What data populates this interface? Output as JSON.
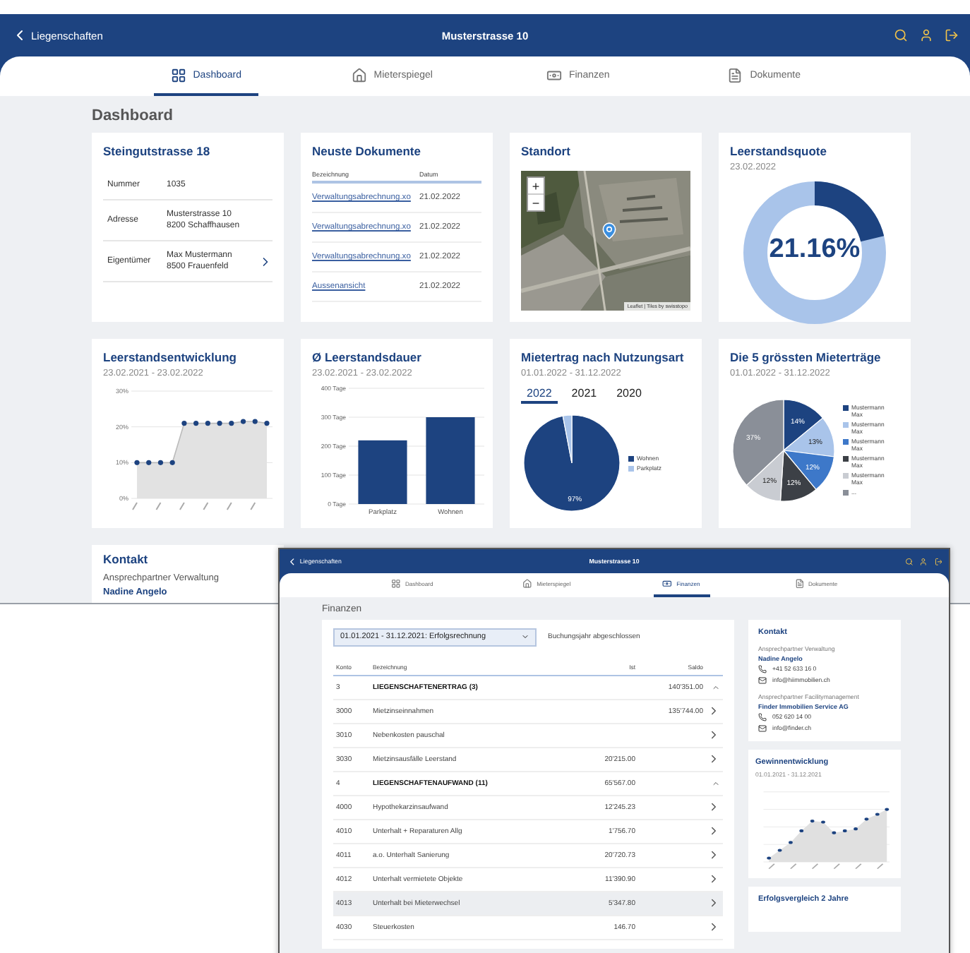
{
  "dashboard_window": {
    "header": {
      "back_label": "Liegenschaften",
      "title": "Musterstrasse 10"
    },
    "tabs": [
      {
        "label": "Dashboard",
        "selected": true
      },
      {
        "label": "Mieterspiegel",
        "selected": false
      },
      {
        "label": "Finanzen",
        "selected": false
      },
      {
        "label": "Dokumente",
        "selected": false
      }
    ],
    "page_title": "Dashboard",
    "property_card": {
      "title": "Steingutstrasse 18",
      "rows": [
        {
          "label": "Nummer",
          "lines": [
            "1035"
          ],
          "link": false
        },
        {
          "label": "Adresse",
          "lines": [
            "Musterstrasse 10",
            "8200 Schaffhausen"
          ],
          "link": false
        },
        {
          "label": "Eigentümer",
          "lines": [
            "Max Mustermann",
            "8500 Frauenfeld"
          ],
          "link": true
        }
      ]
    },
    "documents_card": {
      "title": "Neuste Dokumente",
      "columns": [
        "Bezeichnung",
        "Datum"
      ],
      "rows": [
        {
          "name": "Verwaltungsabrechnung.xo",
          "date": "21.02.2022"
        },
        {
          "name": "Verwaltungsabrechnung.xo",
          "date": "21.02.2022"
        },
        {
          "name": "Verwaltungsabrechnung.xo",
          "date": "21.02.2022"
        },
        {
          "name": "Aussenansicht",
          "date": "21.02.2022"
        }
      ]
    },
    "location_card": {
      "title": "Standort",
      "zoom_in": "+",
      "zoom_out": "−",
      "attribution": "Leaflet | Tiles by swisstopo"
    },
    "vacancy_card": {
      "title": "Leerstandsquote",
      "date": "23.02.2022",
      "reading": "21.16%",
      "level": 0.2116
    },
    "vacancy_trend": {
      "title": "Leerstandsentwicklung",
      "range": "23.02.2021 - 23.02.2022",
      "chart_data": {
        "type": "area",
        "grid": true,
        "values": [
          10,
          10,
          10,
          10,
          21,
          21,
          21,
          21,
          21,
          21.5,
          21.5,
          21
        ],
        "ylim": [
          0,
          30
        ],
        "yticks": [
          {
            "value": 0,
            "label": "0%"
          },
          {
            "value": 10,
            "label": "10%"
          },
          {
            "value": 20,
            "label": "20%"
          },
          {
            "value": 30,
            "label": "30%"
          }
        ]
      }
    },
    "vacancy_duration": {
      "title": "Ø Leerstandsdauer",
      "range": "23.02.2021 - 23.02.2022",
      "chart_data": {
        "type": "bar",
        "grid": true,
        "categories": [
          "Parkplatz",
          "Wohnen"
        ],
        "values": [
          220,
          300
        ],
        "ylim": [
          0,
          400
        ],
        "yticks": [
          {
            "value": 0,
            "label": "0 Tage"
          },
          {
            "value": 100,
            "label": "100 Tage"
          },
          {
            "value": 200,
            "label": "200 Tage"
          },
          {
            "value": 300,
            "label": "300 Tage"
          },
          {
            "value": 400,
            "label": "400 Tage"
          }
        ]
      }
    },
    "income_by_use": {
      "title": "Mietertrag nach Nutzungsart",
      "range": "01.01.2022 - 31.12.2022",
      "years": [
        {
          "label": "2022",
          "selected": true
        },
        {
          "label": "2021",
          "selected": false
        },
        {
          "label": "2020",
          "selected": false
        }
      ],
      "chart_data": {
        "type": "pie",
        "categories": [
          "Wohnen",
          "Parkplatz"
        ],
        "values": [
          97,
          3
        ],
        "value_labels": [
          "97%",
          null
        ]
      }
    },
    "top_income": {
      "title": "Die 5 grössten Mieterträge",
      "range": "01.01.2022 - 31.12.2022",
      "chart_data": {
        "type": "pie",
        "categories": [
          "Mustermann Max",
          "Mustermann Max",
          "Mustermann Max",
          "Mustermann Max",
          "Mustermann Max",
          "..."
        ],
        "values": [
          14,
          13,
          12,
          12,
          12,
          37
        ],
        "value_labels": [
          "14%",
          "13%",
          "12%",
          "12%",
          "12%",
          "37%"
        ]
      }
    },
    "contact_card": {
      "title": "Kontakt",
      "subtitle": "Ansprechpartner Verwaltung",
      "name": "Nadine Angelo"
    }
  },
  "finance_window": {
    "header": {
      "back_label": "Liegenschaften",
      "title": "Musterstrasse 10"
    },
    "tabs": [
      {
        "label": "Dashboard",
        "selected": false
      },
      {
        "label": "Mieterspiegel",
        "selected": false
      },
      {
        "label": "Finanzen",
        "selected": true
      },
      {
        "label": "Dokumente",
        "selected": false
      }
    ],
    "page_title": "Finanzen",
    "period": "01.01.2021 - 31.12.2021: Erfolgsrechnung",
    "status": "Buchungsjahr abgeschlossen",
    "columns": [
      "Konto",
      "Bezeichnung",
      "Ist",
      "Saldo"
    ],
    "rows": [
      {
        "kind": "group",
        "account": "3",
        "name": "LIEGENSCHAFTENERTRAG (3)",
        "actual": "",
        "balance": "140'351.00",
        "expanded": true,
        "selected": false
      },
      {
        "kind": "item",
        "account": "3000",
        "name": "Mietzinseinnahmen",
        "actual": "",
        "balance": "135'744.00",
        "selected": false
      },
      {
        "kind": "item",
        "account": "3010",
        "name": "Nebenkosten pauschal",
        "actual": "",
        "balance": "",
        "selected": false
      },
      {
        "kind": "item",
        "account": "3030",
        "name": "Mietzinsausfälle Leerstand",
        "actual": "20'215.00",
        "balance": "",
        "selected": false
      },
      {
        "kind": "group",
        "account": "4",
        "name": "LIEGENSCHAFTENAUFWAND (11)",
        "actual": "65'567.00",
        "balance": "",
        "expanded": true,
        "selected": false
      },
      {
        "kind": "item",
        "account": "4000",
        "name": "Hypothekarzinsaufwand",
        "actual": "12'245.23",
        "balance": "",
        "selected": false
      },
      {
        "kind": "item",
        "account": "4010",
        "name": "Unterhalt + Reparaturen Allg",
        "actual": "1'756.70",
        "balance": "",
        "selected": false
      },
      {
        "kind": "item",
        "account": "4011",
        "name": "a.o. Unterhalt Sanierung",
        "actual": "20'720.73",
        "balance": "",
        "selected": false
      },
      {
        "kind": "item",
        "account": "4012",
        "name": "Unterhalt vermietete Objekte",
        "actual": "11'390.90",
        "balance": "",
        "selected": false
      },
      {
        "kind": "item",
        "account": "4013",
        "name": "Unterhalt bei Mieterwechsel",
        "actual": "5'347.80",
        "balance": "",
        "selected": true
      },
      {
        "kind": "item",
        "account": "4030",
        "name": "Steuerkosten",
        "actual": "146.70",
        "balance": "",
        "selected": false
      }
    ],
    "contact": {
      "title": "Kontakt",
      "groups": [
        {
          "role": "Ansprechpartner Verwaltung",
          "name": "Nadine Angelo",
          "phone": "+41 52 633 16 0",
          "mail": "info@hiimmobilien.ch"
        },
        {
          "role": "Ansprechpartner Facilitymanagement",
          "name": "Finder Immobilien Service AG",
          "phone": "052 620 14 00",
          "mail": "info@finder.ch"
        }
      ]
    },
    "profit": {
      "title": "Gewinnentwicklung",
      "range": "01.01.2021 - 31.12.2021"
    },
    "comparison": {
      "title": "Erfolgsvergleich 2 Jahre"
    }
  }
}
